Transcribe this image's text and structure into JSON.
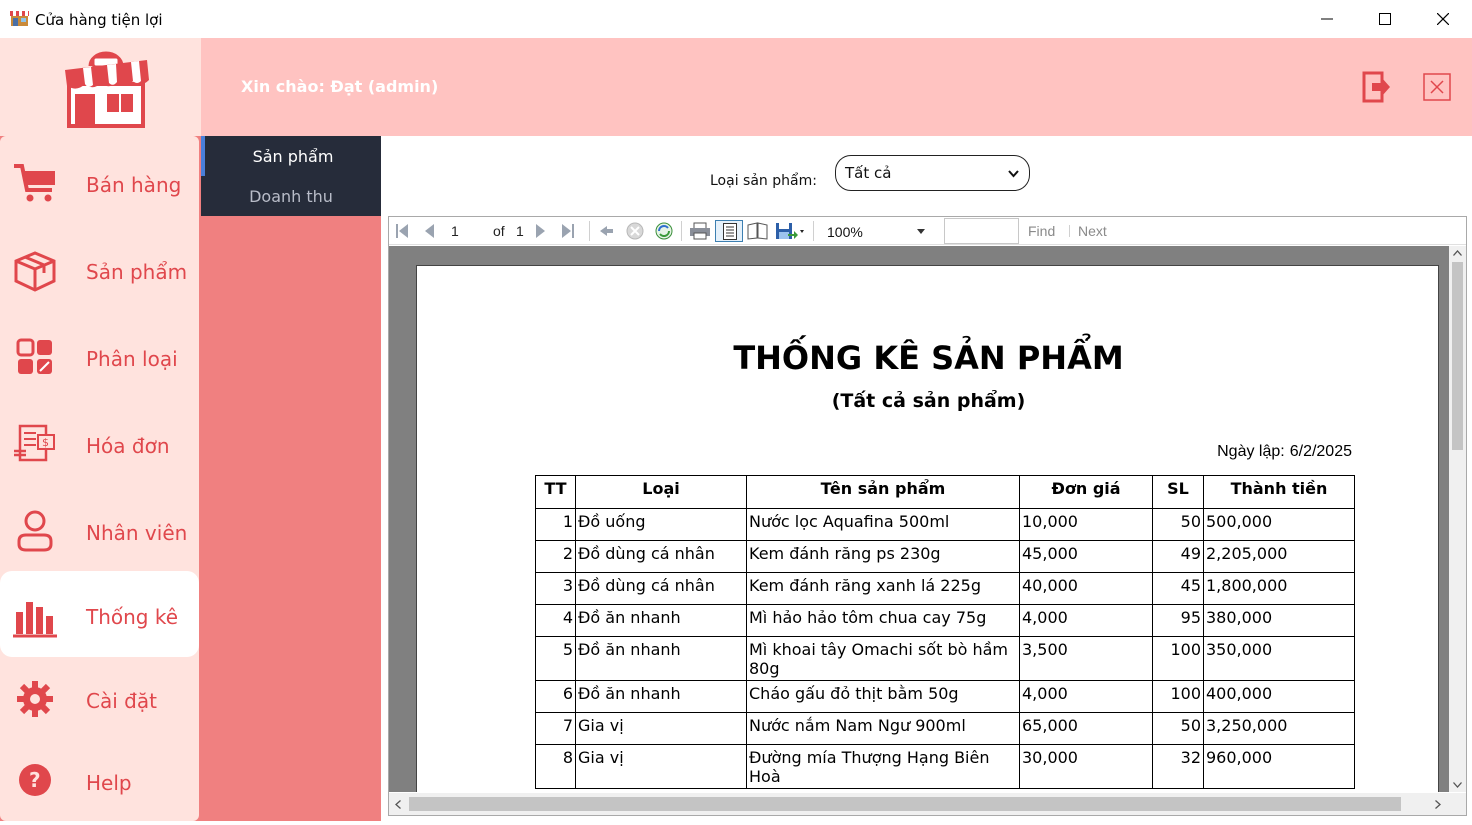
{
  "window": {
    "title": "Cửa hàng tiện lợi",
    "controls": [
      "minimize-icon",
      "maximize-icon",
      "close-icon"
    ]
  },
  "header": {
    "greeting": "Xin chào: Đạt (admin)",
    "buttons": [
      "logout-icon",
      "exit-icon"
    ]
  },
  "sidebar": {
    "items": [
      {
        "label": "Bán hàng",
        "icon": "cart-icon"
      },
      {
        "label": "Sản phẩm",
        "icon": "box-icon"
      },
      {
        "label": "Phân loại",
        "icon": "category-icon"
      },
      {
        "label": "Hóa đơn",
        "icon": "invoice-icon"
      },
      {
        "label": "Nhân viên",
        "icon": "user-icon"
      },
      {
        "label": "Thống kê",
        "icon": "bar-chart-icon",
        "active": true
      },
      {
        "label": "Cài đặt",
        "icon": "gear-icon"
      },
      {
        "label": "Help",
        "icon": "help-icon"
      }
    ]
  },
  "submenu": {
    "items": [
      {
        "label": "Sản phẩm",
        "active": true
      },
      {
        "label": "Doanh thu",
        "active": false
      }
    ]
  },
  "filter": {
    "label": "Loại sản phẩm:",
    "selected": "Tất cả"
  },
  "toolbar": {
    "page": "1",
    "of_label": "of",
    "total_pages": "1",
    "zoom": "100%",
    "find_label": "Find",
    "next_label": "Next"
  },
  "report": {
    "title": "THỐNG KÊ SẢN PHẨM",
    "subtitle": "(Tất cả sản phẩm)",
    "date_label": "Ngày lập:",
    "date_value": "6/2/2025",
    "columns": [
      "TT",
      "Loại",
      "Tên sản phẩm",
      "Đơn giá",
      "SL",
      "Thành tiền"
    ],
    "rows": [
      [
        "1",
        "Đồ uống",
        "Nước lọc Aquafina 500ml",
        "10,000",
        "50",
        "500,000"
      ],
      [
        "2",
        "Đồ dùng cá nhân",
        "Kem đánh răng ps 230g",
        "45,000",
        "49",
        "2,205,000"
      ],
      [
        "3",
        "Đồ dùng cá nhân",
        "Kem đánh răng xanh lá 225g",
        "40,000",
        "45",
        "1,800,000"
      ],
      [
        "4",
        "Đồ ăn nhanh",
        "Mì hảo hảo tôm chua cay 75g",
        "4,000",
        "95",
        "380,000"
      ],
      [
        "5",
        "Đồ ăn nhanh",
        "Mì khoai tây Omachi sốt bò hầm 80g",
        "3,500",
        "100",
        "350,000"
      ],
      [
        "6",
        "Đồ ăn nhanh",
        "Cháo gấu đỏ thịt bằm 50g",
        "4,000",
        "100",
        "400,000"
      ],
      [
        "7",
        "Gia vị",
        "Nước nắm Nam Ngư 900ml",
        "65,000",
        "50",
        "3,250,000"
      ],
      [
        "8",
        "Gia vị",
        "Đường mía Thượng Hạng Biên Hoà",
        "30,000",
        "32",
        "960,000"
      ]
    ]
  },
  "colors": {
    "accent": "#e0474c",
    "header_bg": "#ffc3c1",
    "sidebar_bg": "#ffe3de",
    "submenu_bg": "#262c3a",
    "coral": "#f08080"
  }
}
